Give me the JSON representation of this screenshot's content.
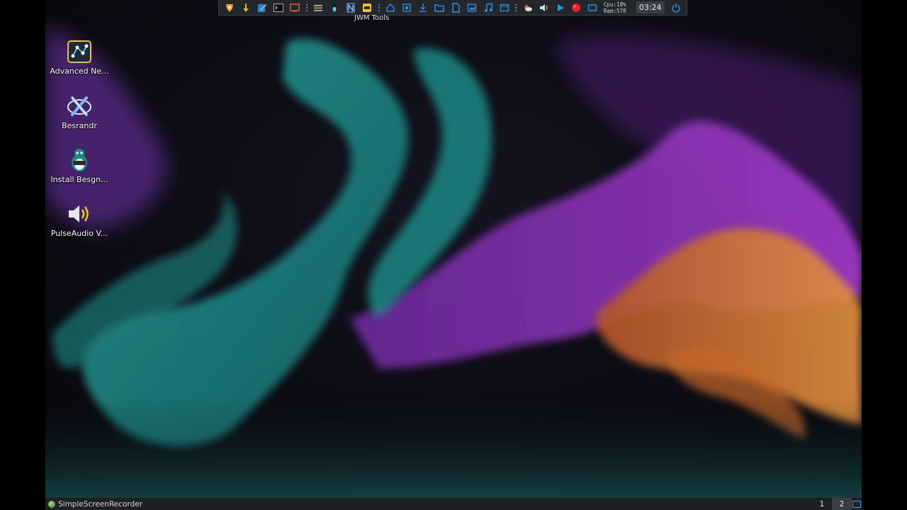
{
  "top_panel": {
    "launchers": [
      {
        "icon": "brave-lion-icon"
      },
      {
        "icon": "download-arrow-icon"
      },
      {
        "icon": "text-editor-icon"
      },
      {
        "icon": "terminal-icon"
      },
      {
        "icon": "screen-icon"
      },
      {
        "icon": "menu-lines-icon"
      },
      {
        "icon": "tux-icon"
      },
      {
        "icon": "jwm-tools-icon"
      },
      {
        "icon": "yellow-app-icon"
      }
    ],
    "places": [
      {
        "icon": "home-icon"
      },
      {
        "icon": "window-icon"
      },
      {
        "icon": "downloads-icon"
      },
      {
        "icon": "folder-open-icon"
      },
      {
        "icon": "document-icon"
      },
      {
        "icon": "pictures-icon"
      },
      {
        "icon": "music-icon"
      },
      {
        "icon": "video-icon"
      }
    ],
    "system": {
      "cpu": "Cpu:18%",
      "ram": "Ram:578",
      "clock": "03:24"
    },
    "tooltip": "JWM Tools"
  },
  "desktop_icons": [
    {
      "label": "Advanced Ne...",
      "icon": "network-manager-icon"
    },
    {
      "label": "Besrandr",
      "icon": "display-settings-icon"
    },
    {
      "label": "Install Besgn...",
      "icon": "installer-penguin-icon"
    },
    {
      "label": "PulseAudio V...",
      "icon": "speaker-icon"
    }
  ],
  "taskbar": {
    "task_label": "SimpleScreenRecorder",
    "desktops": [
      "1",
      "2"
    ],
    "active_desktop": "2"
  },
  "colors": {
    "panel_bg": "#23262b",
    "accent_blue": "#2f8fe6",
    "record_red": "#e0242c",
    "teal_smoke": "#1f8f8a",
    "purple_smoke": "#8a2bb5",
    "orange_smoke": "#d9782e"
  }
}
